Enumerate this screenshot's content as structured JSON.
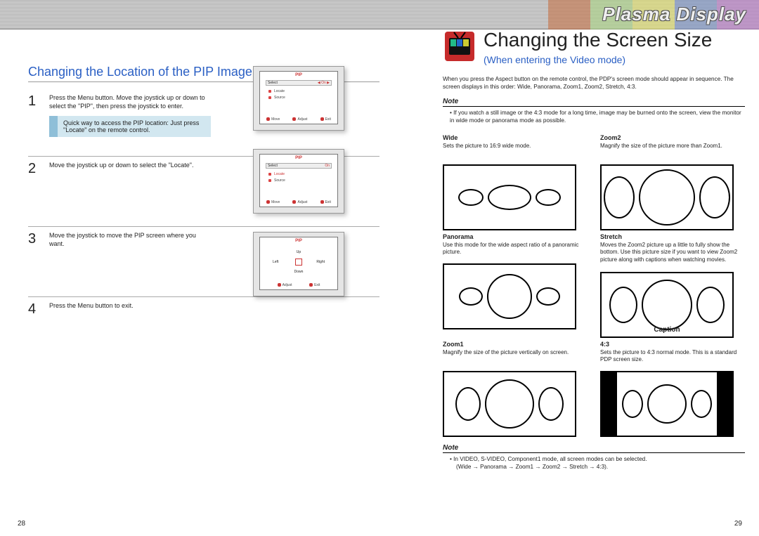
{
  "brand": "Plasma Display",
  "left": {
    "section_title": "Changing the Location of the PIP Image",
    "steps": [
      {
        "num": "1",
        "text": "Press the Menu button. Move the joystick up or down to select the \"PIP\", then press the joystick to enter."
      },
      {
        "num": "2",
        "text": "Move the joystick up or down to select the \"Locate\"."
      },
      {
        "num": "3",
        "text": "Move the joystick to move the PIP screen where you want."
      },
      {
        "num": "4",
        "text": "Press the Menu button to exit."
      }
    ],
    "tip": "Quick way to access the PIP location: Just press \"Locate\" on the remote control.",
    "osd": {
      "title": "PIP",
      "select_label": "Select",
      "select_value": "On",
      "items": [
        "Locate",
        "Source"
      ],
      "foot": [
        "Move",
        "Adjust",
        "Exit"
      ],
      "dirs": [
        "Up",
        "Left",
        "Right",
        "Down"
      ]
    },
    "pagenum": "28"
  },
  "right": {
    "title": "Changing the Screen Size",
    "subtitle": "(When entering the Video mode)",
    "intro": "When you press the Aspect button on the remote control, the PDP's screen mode should appear in sequence. The screen displays in this order: Wide, Panorama, Zoom1, Zoom2, Stretch, 4:3.",
    "note1_head": "Note",
    "note1_body": "If you watch a still image or the 4:3 mode for a long time, image may be burned onto the screen, view the monitor in wide mode or panorama mode as possible.",
    "modes": {
      "wide": {
        "title": "Wide",
        "desc": "Sets the picture to 16:9 wide mode."
      },
      "zoom2": {
        "title": "Zoom2",
        "desc": "Magnify the size of the picture more than Zoom1."
      },
      "panorama": {
        "title": "Panorama",
        "desc": "Use this mode for the wide aspect ratio of a panoramic picture."
      },
      "stretch": {
        "title": "Stretch",
        "desc": "Moves the Zoom2 picture up a little to fully show the bottom. Use this picture size if you want to view Zoom2 picture along with captions when watching movies.",
        "caption": "Caption"
      },
      "zoom1": {
        "title": "Zoom1",
        "desc": "Magnify the size of the picture vertically on screen."
      },
      "a43": {
        "title": "4:3",
        "desc": "Sets the picture to 4:3 normal mode. This is a standard PDP screen size."
      }
    },
    "note2_head": "Note",
    "note2_line1": "In VIDEO, S-VIDEO, Component1 mode, all screen modes can be selected.",
    "note2_line2": "(Wide → Panorama → Zoom1 → Zoom2 → Stretch → 4:3).",
    "pagenum": "29"
  }
}
